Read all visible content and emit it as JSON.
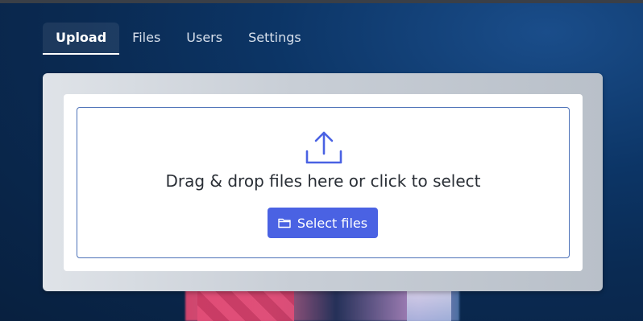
{
  "tabs": [
    {
      "label": "Upload",
      "active": true
    },
    {
      "label": "Files",
      "active": false
    },
    {
      "label": "Users",
      "active": false
    },
    {
      "label": "Settings",
      "active": false
    }
  ],
  "dropzone": {
    "icon": "upload-icon",
    "text": "Drag & drop files here or click to select",
    "button_label": "Select files",
    "button_icon": "folder-icon"
  },
  "colors": {
    "accent": "#4a62e3",
    "dropzone_border": "#4d72b8",
    "background": "#0c3566"
  }
}
